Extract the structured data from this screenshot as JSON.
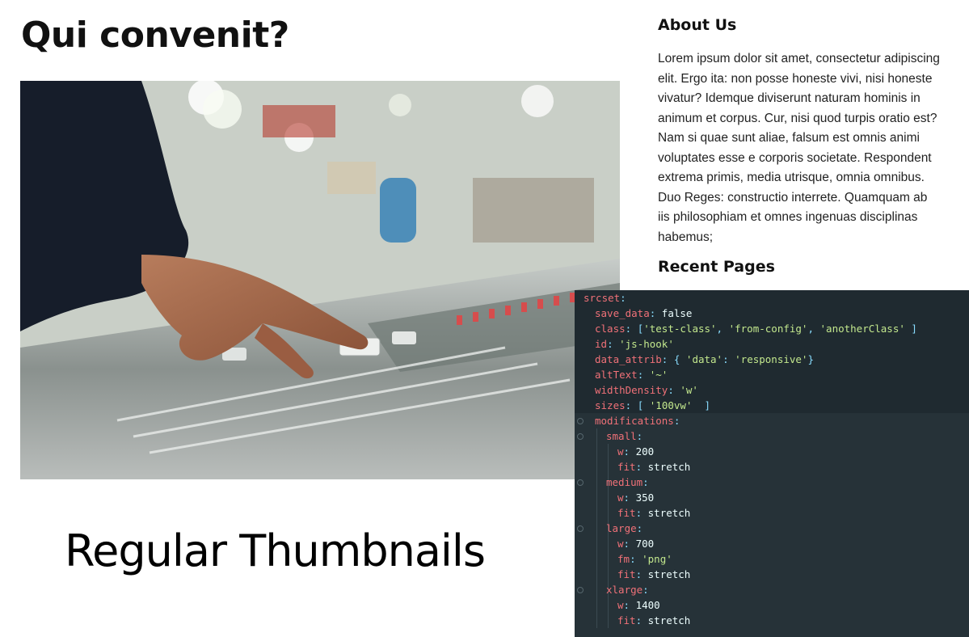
{
  "page": {
    "title": "Qui convenit?"
  },
  "hero": {
    "alt": "hand adjusting faders on an audio mixing console"
  },
  "sidebar": {
    "about_heading": "About Us",
    "about_text": "Lorem ipsum dolor sit amet, consectetur adipiscing elit. Ergo ita: non posse honeste vivi, nisi honeste vivatur? Idemque diviserunt naturam hominis in animum et corpus. Cur, nisi quod turpis oratio est? Nam si quae sunt aliae, falsum est omnis animi voluptates esse e corporis societate. Respondent extrema primis, media utrisque, omnia omnibus. Duo Reges: constructio interrete. Quamquam ab iis philosophiam et omnes ingenuas disciplinas habemus;",
    "recent_heading": "Recent Pages"
  },
  "caption": "Regular Thumbnails",
  "editor": {
    "lines": [
      {
        "indent": 0,
        "parts": [
          {
            "t": "srcset",
            "c": "key"
          },
          {
            "t": ":",
            "c": "punc"
          }
        ]
      },
      {
        "indent": 1,
        "parts": [
          {
            "t": "save_data",
            "c": "key"
          },
          {
            "t": ": ",
            "c": "punc"
          },
          {
            "t": "false",
            "c": "plain"
          }
        ]
      },
      {
        "indent": 1,
        "parts": [
          {
            "t": "class",
            "c": "key"
          },
          {
            "t": ": ",
            "c": "punc"
          },
          {
            "t": "[",
            "c": "punc"
          },
          {
            "t": "'test-class'",
            "c": "str"
          },
          {
            "t": ", ",
            "c": "punc"
          },
          {
            "t": "'from-config'",
            "c": "str"
          },
          {
            "t": ", ",
            "c": "punc"
          },
          {
            "t": "'anotherClass'",
            "c": "str"
          },
          {
            "t": " ]",
            "c": "punc"
          }
        ]
      },
      {
        "indent": 1,
        "parts": [
          {
            "t": "id",
            "c": "key"
          },
          {
            "t": ": ",
            "c": "punc"
          },
          {
            "t": "'js-hook'",
            "c": "str"
          }
        ]
      },
      {
        "indent": 1,
        "parts": [
          {
            "t": "data_attrib",
            "c": "key"
          },
          {
            "t": ": ",
            "c": "punc"
          },
          {
            "t": "{ ",
            "c": "punc"
          },
          {
            "t": "'data'",
            "c": "str"
          },
          {
            "t": ": ",
            "c": "punc"
          },
          {
            "t": "'responsive'",
            "c": "str"
          },
          {
            "t": "}",
            "c": "punc"
          }
        ]
      },
      {
        "indent": 1,
        "parts": [
          {
            "t": "altText",
            "c": "key"
          },
          {
            "t": ": ",
            "c": "punc"
          },
          {
            "t": "'~'",
            "c": "str"
          }
        ]
      },
      {
        "indent": 1,
        "parts": [
          {
            "t": "widthDensity",
            "c": "key"
          },
          {
            "t": ": ",
            "c": "punc"
          },
          {
            "t": "'w'",
            "c": "str"
          }
        ]
      },
      {
        "indent": 1,
        "parts": [
          {
            "t": "sizes",
            "c": "key"
          },
          {
            "t": ": ",
            "c": "punc"
          },
          {
            "t": "[ ",
            "c": "punc"
          },
          {
            "t": "'100vw'",
            "c": "str"
          },
          {
            "t": "  ]",
            "c": "punc"
          }
        ]
      },
      {
        "indent": 1,
        "fold": true,
        "parts": [
          {
            "t": "modifications",
            "c": "key"
          },
          {
            "t": ":",
            "c": "punc"
          }
        ]
      },
      {
        "indent": 2,
        "fold": true,
        "parts": [
          {
            "t": "small",
            "c": "key"
          },
          {
            "t": ":",
            "c": "punc"
          }
        ]
      },
      {
        "indent": 3,
        "parts": [
          {
            "t": "w",
            "c": "key"
          },
          {
            "t": ": ",
            "c": "punc"
          },
          {
            "t": "200",
            "c": "plain"
          }
        ]
      },
      {
        "indent": 3,
        "parts": [
          {
            "t": "fit",
            "c": "key"
          },
          {
            "t": ": ",
            "c": "punc"
          },
          {
            "t": "stretch",
            "c": "plain"
          }
        ]
      },
      {
        "indent": 2,
        "fold": true,
        "parts": [
          {
            "t": "medium",
            "c": "key"
          },
          {
            "t": ":",
            "c": "punc"
          }
        ]
      },
      {
        "indent": 3,
        "parts": [
          {
            "t": "w",
            "c": "key"
          },
          {
            "t": ": ",
            "c": "punc"
          },
          {
            "t": "350",
            "c": "plain"
          }
        ]
      },
      {
        "indent": 3,
        "parts": [
          {
            "t": "fit",
            "c": "key"
          },
          {
            "t": ": ",
            "c": "punc"
          },
          {
            "t": "stretch",
            "c": "plain"
          }
        ]
      },
      {
        "indent": 2,
        "fold": true,
        "parts": [
          {
            "t": "large",
            "c": "key"
          },
          {
            "t": ":",
            "c": "punc"
          }
        ]
      },
      {
        "indent": 3,
        "parts": [
          {
            "t": "w",
            "c": "key"
          },
          {
            "t": ": ",
            "c": "punc"
          },
          {
            "t": "700",
            "c": "plain"
          }
        ]
      },
      {
        "indent": 3,
        "parts": [
          {
            "t": "fm",
            "c": "key"
          },
          {
            "t": ": ",
            "c": "punc"
          },
          {
            "t": "'png'",
            "c": "str"
          }
        ]
      },
      {
        "indent": 3,
        "parts": [
          {
            "t": "fit",
            "c": "key"
          },
          {
            "t": ": ",
            "c": "punc"
          },
          {
            "t": "stretch",
            "c": "plain"
          }
        ]
      },
      {
        "indent": 2,
        "fold": true,
        "parts": [
          {
            "t": "xlarge",
            "c": "key"
          },
          {
            "t": ":",
            "c": "punc"
          }
        ]
      },
      {
        "indent": 3,
        "parts": [
          {
            "t": "w",
            "c": "key"
          },
          {
            "t": ": ",
            "c": "punc"
          },
          {
            "t": "1400",
            "c": "plain"
          }
        ]
      },
      {
        "indent": 3,
        "parts": [
          {
            "t": "fit",
            "c": "key"
          },
          {
            "t": ": ",
            "c": "punc"
          },
          {
            "t": "stretch",
            "c": "plain"
          }
        ]
      }
    ]
  }
}
